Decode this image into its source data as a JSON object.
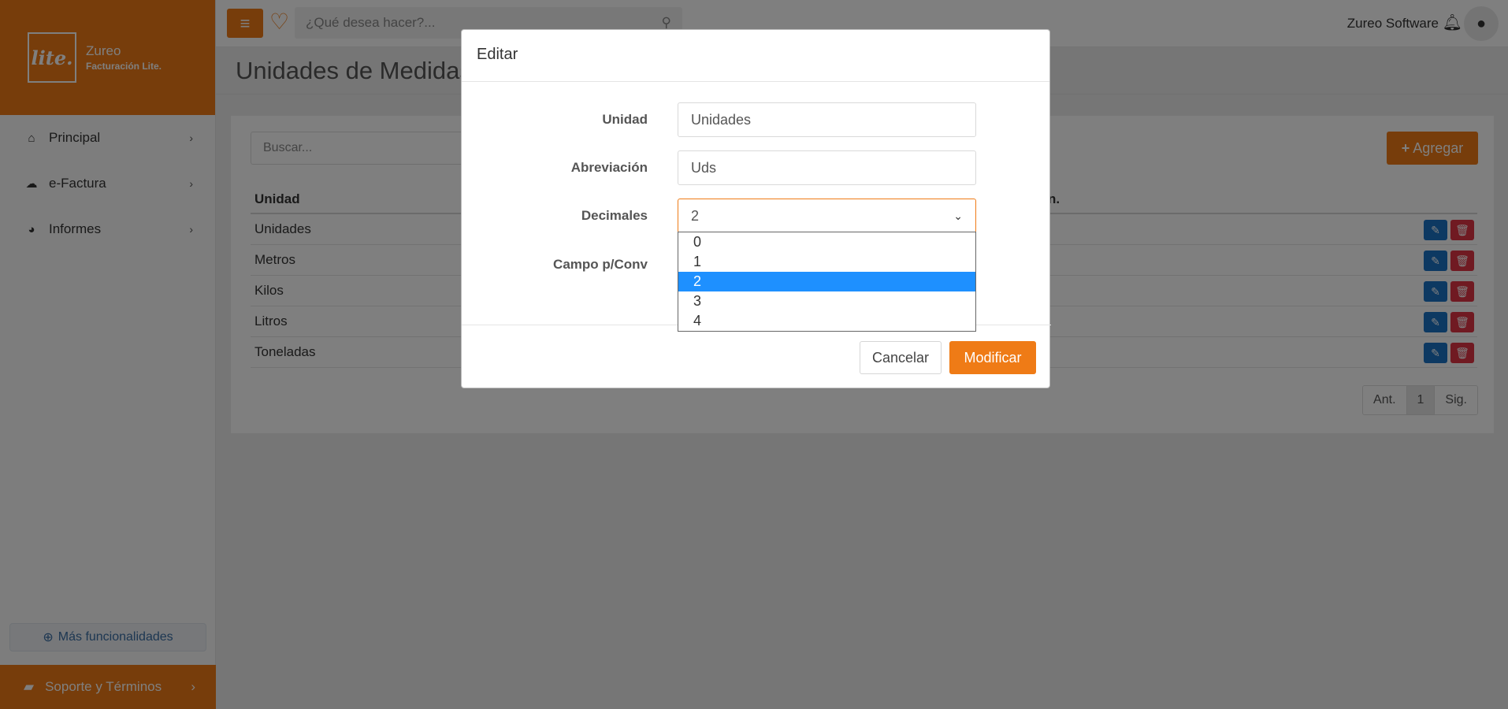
{
  "brand": {
    "logo_text": "lite.",
    "name": "Zureo",
    "product": "Facturación Lite.",
    "color": "#ef7b16"
  },
  "sidebar": {
    "items": [
      {
        "label": "Principal",
        "icon": "home-icon"
      },
      {
        "label": "e-Factura",
        "icon": "cloud-icon"
      },
      {
        "label": "Informes",
        "icon": "pie-chart-icon"
      }
    ],
    "more_label": "Más funcionalidades",
    "support_label": "Soporte y Términos"
  },
  "topbar": {
    "search_placeholder": "¿Qué desea hacer?...",
    "user_name": "Zureo Software"
  },
  "page": {
    "title": "Unidades de Medidas",
    "search_placeholder": "Buscar...",
    "add_label": "Agregar",
    "columns": [
      "Unidad",
      "n."
    ],
    "rows": [
      "Unidades",
      "Metros",
      "Kilos",
      "Litros",
      "Toneladas"
    ],
    "pager": {
      "prev": "Ant.",
      "current": "1",
      "next": "Sig."
    }
  },
  "modal": {
    "title": "Editar",
    "fields": {
      "unidad": {
        "label": "Unidad",
        "value": "Unidades"
      },
      "abreviacion": {
        "label": "Abreviación",
        "value": "Uds"
      },
      "decimales": {
        "label": "Decimales",
        "value": "2",
        "options": [
          "0",
          "1",
          "2",
          "3",
          "4"
        ]
      },
      "campo_conv": {
        "label": "Campo p/Conv"
      }
    },
    "cancel_label": "Cancelar",
    "submit_label": "Modificar"
  }
}
